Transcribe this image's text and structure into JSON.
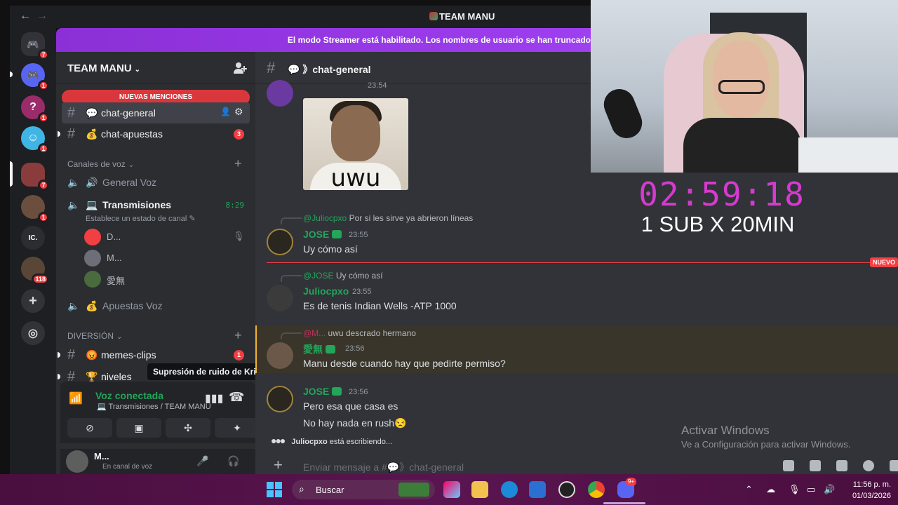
{
  "window": {
    "title": "TEAM MANU"
  },
  "banner": {
    "text": "El modo Streamer está habilitado. Los nombres de usuario se han truncado"
  },
  "servers": [
    {
      "name": "discord-home",
      "badge": "7",
      "color": "#5865f2"
    },
    {
      "name": "server-discord",
      "badge": "1",
      "color": "#5865f2"
    },
    {
      "name": "server-question",
      "badge": "1",
      "color": "#9b2c6a"
    },
    {
      "name": "server-face",
      "badge": "1",
      "color": "#3fb5e6"
    },
    {
      "name": "server-team-manu",
      "badge": "7",
      "color": "#8a3b3b"
    },
    {
      "name": "server-green",
      "badge": "1",
      "color": "#6b4e3d"
    },
    {
      "name": "server-ic",
      "badge": "",
      "color": "#2b2d31",
      "text": "IC."
    },
    {
      "name": "server-photo",
      "badge": "118",
      "color": "#5a4636"
    }
  ],
  "sidebar": {
    "guild_name": "TEAM MANU",
    "mentions_banner": "NUEVAS MENCIONES",
    "channels": [
      {
        "emoji": "💬",
        "label": "chat-general"
      },
      {
        "emoji": "💰",
        "label": "chat-apuestas",
        "badge": "3"
      }
    ],
    "voice_category": "Canales de voz",
    "voice_channels": [
      {
        "emoji": "🔊",
        "label": "General Voz"
      },
      {
        "emoji": "💻",
        "label": "Transmisiones",
        "time": "8:29",
        "status": "Establece un estado de canal ✎"
      },
      {
        "emoji": "💰",
        "label": "Apuestas Voz"
      }
    ],
    "voice_users": [
      "D...",
      "M...",
      "愛無"
    ],
    "diversion_category": "DIVERSIÓN",
    "diversion_channels": [
      {
        "emoji": "😡",
        "label": "memes-clips",
        "badge": "1"
      },
      {
        "emoji": "🏆",
        "label": "niveles"
      }
    ]
  },
  "tooltip": "Supresión de ruido de Krisp",
  "voice_panel": {
    "title": "Voz conectada",
    "subtitle": "💻 Transmisiones / TEAM MANU"
  },
  "user_panel": {
    "name": "M...",
    "status": "En canal de voz"
  },
  "chat": {
    "channel": "chat-general",
    "top_time": "23:54",
    "meme_text": "uwu",
    "messages": [
      {
        "reply_author": "@Juliocpxo",
        "reply_text": "Por si les sirve ya abrieron líneas",
        "author": "JOSE",
        "time": "23:55",
        "text": "Uy cómo así"
      },
      {
        "reply_author": "@JOSE",
        "reply_text": "Uy cómo así",
        "author": "Juliocpxo",
        "time": "23:55",
        "text": "Es de tenis Indian Wells -ATP 1000"
      },
      {
        "reply_author": "@M...",
        "reply_text": "uwu descrado hermano",
        "author": "愛無",
        "time": "23:56",
        "text": "Manu desde cuando hay que pedirte permiso?"
      },
      {
        "author": "JOSE",
        "time": "23:56",
        "text": "Pero esa que casa es",
        "text2": "No hay nada en rush😒"
      }
    ],
    "new_tag": "NUEVO",
    "typing_user": "Juliocpxo",
    "typing_suffix": "está escribiendo...",
    "composer_placeholder": "Enviar mensaje a #💬》chat-general"
  },
  "activate_windows": {
    "title": "Activar Windows",
    "subtitle": "Ve a Configuración para activar Windows."
  },
  "overlay": {
    "timer": "02:59:18",
    "subtext": "1 SUB X 20MIN"
  },
  "taskbar": {
    "search": "Buscar",
    "time": "11:56 p. m.",
    "date": "01/03/2026",
    "discord_badge": "9+"
  }
}
